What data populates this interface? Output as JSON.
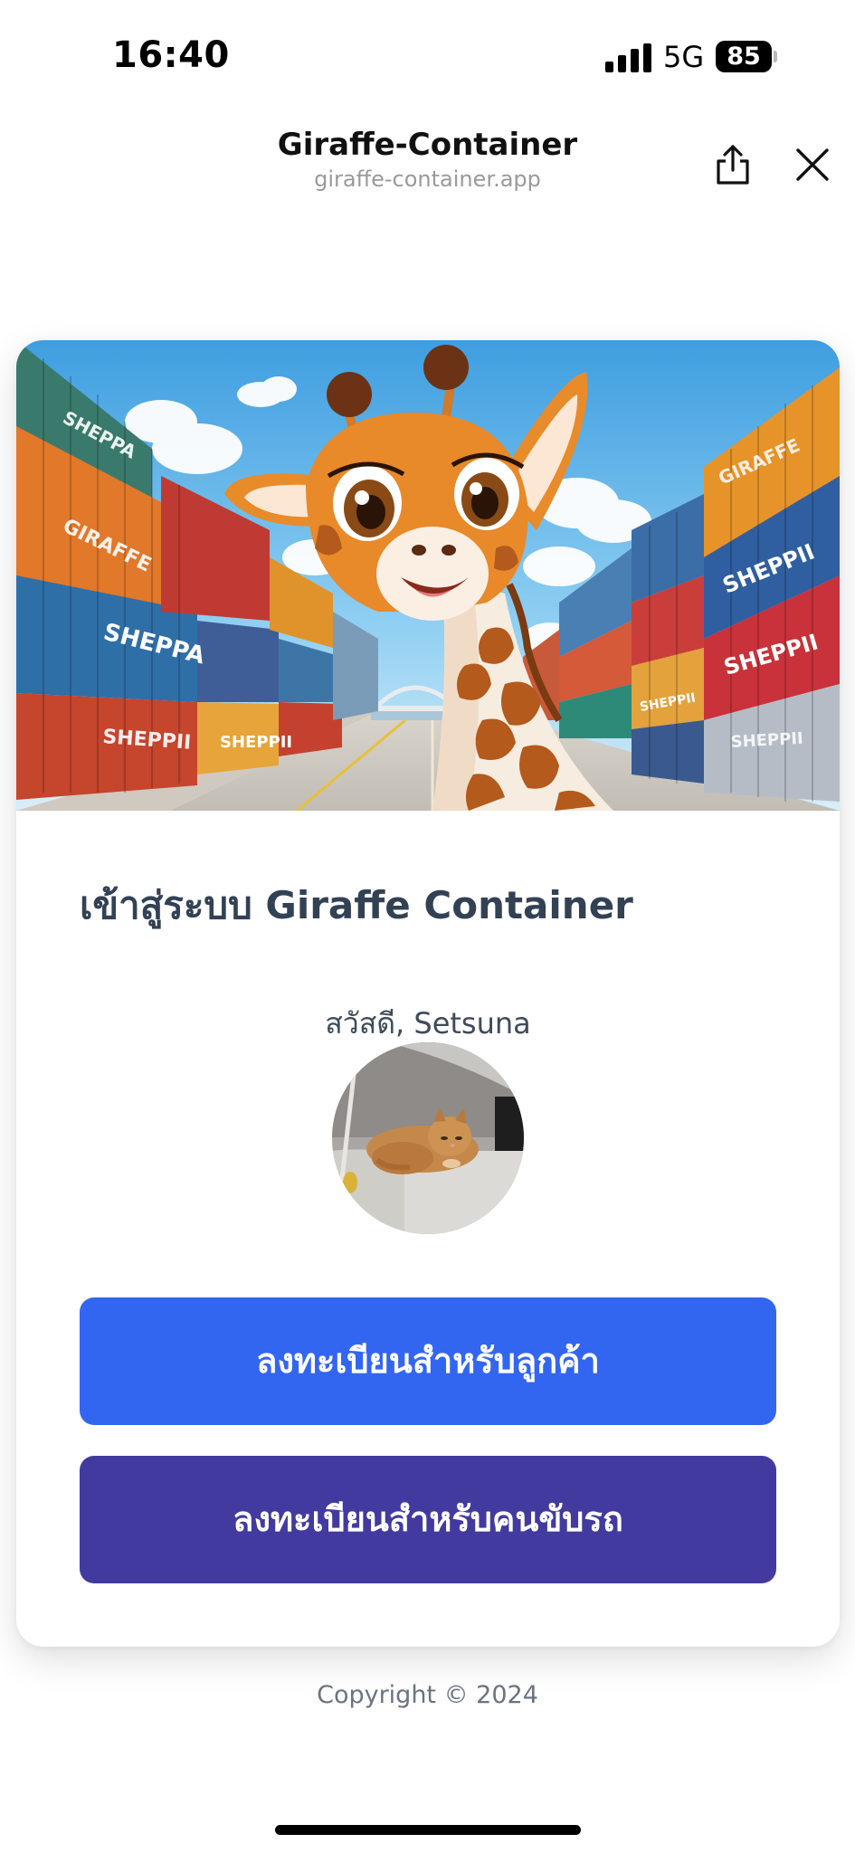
{
  "status_bar": {
    "time": "16:40",
    "network": "5G",
    "battery": "85"
  },
  "browser": {
    "title": "Giraffe-Container",
    "url": "giraffe-container.app",
    "icons": {
      "share": "share-icon",
      "close": "close-icon"
    }
  },
  "hero_image": {
    "container_brands": [
      "SHEPPA",
      "SHEPPII",
      "GIRAFFE"
    ]
  },
  "login": {
    "title": "เข้าสู่ระบบ Giraffe Container",
    "greeting": "สวัสดี, Setsuna",
    "buttons": {
      "customer": "ลงทะเบียนสำหรับลูกค้า",
      "driver": "ลงทะเบียนสำหรับคนขับรถ"
    }
  },
  "footer": {
    "copyright": "Copyright © 2024"
  },
  "colors": {
    "primary": "#3366f0",
    "secondary": "#433a9f",
    "title_text": "#334155"
  }
}
